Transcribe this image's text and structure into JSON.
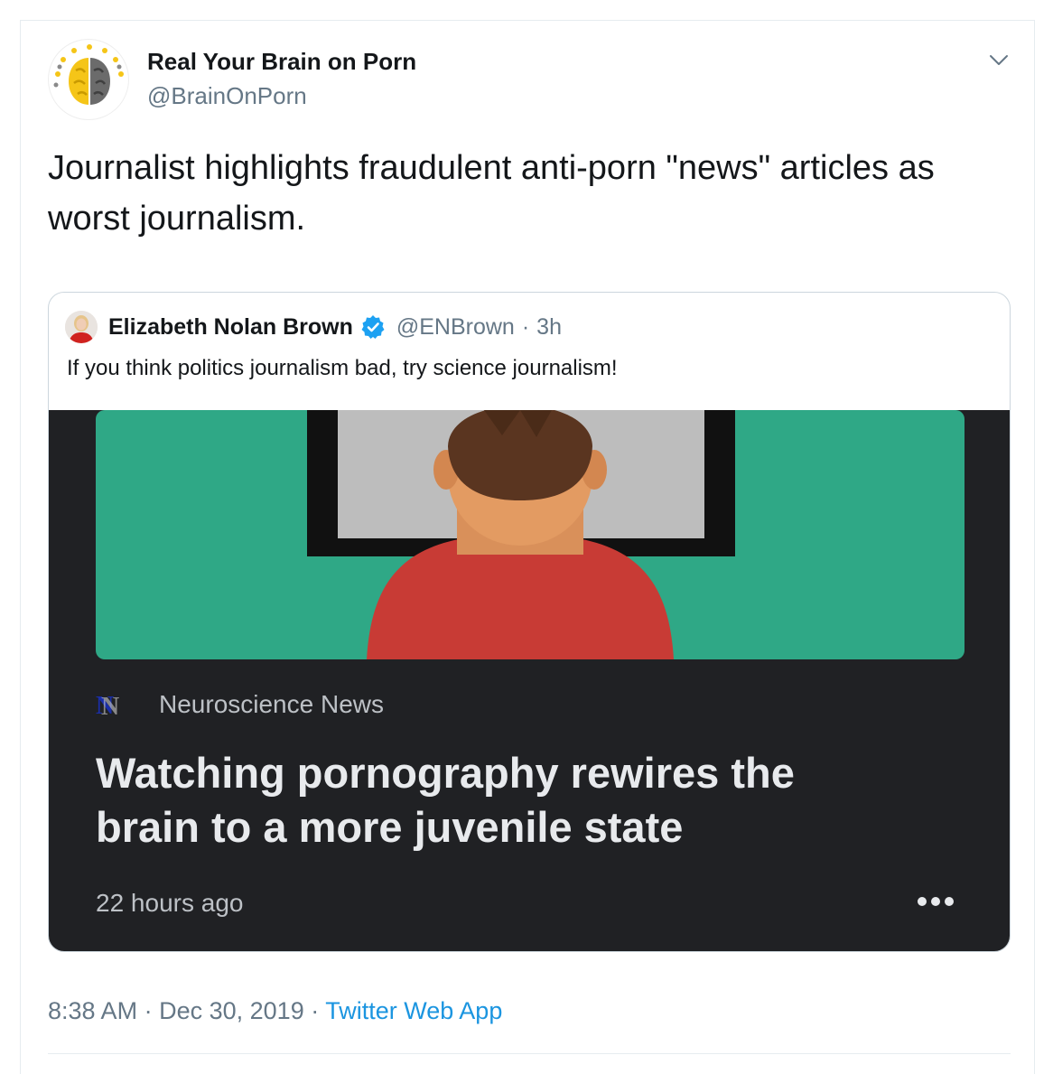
{
  "tweet": {
    "author": {
      "name": "Real Your Brain on Porn",
      "handle": "@BrainOnPorn",
      "avatar_icon": "brain-sun-logo-icon"
    },
    "text": "Journalist highlights fraudulent anti-porn \"news\" articles as worst journalism.",
    "more_menu_icon": "chevron-down-icon",
    "meta": {
      "time": "8:38 AM",
      "separator": "·",
      "date": "Dec 30, 2019",
      "app": "Twitter Web App"
    }
  },
  "quoted_tweet": {
    "author": {
      "name": "Elizabeth Nolan Brown",
      "handle": "@ENBrown",
      "verified_icon": "verified-badge-icon",
      "separator": "·",
      "time_ago": "3h"
    },
    "text": "If you think politics journalism bad, try science journalism!",
    "media": {
      "illustration": "person-watching-screen-illustration",
      "source_logo": "N",
      "source": "Neuroscience News",
      "headline": "Watching pornography rewires the brain to a more juvenile state",
      "time_ago": "22 hours ago",
      "more_icon": "more-horizontal-icon"
    }
  },
  "colors": {
    "text_primary": "#14171a",
    "text_secondary": "#657786",
    "link": "#1b95e0",
    "verified": "#1da1f2",
    "card_bg": "#202124",
    "illustration_green": "#2fa886",
    "shirt_red": "#c83b35"
  }
}
